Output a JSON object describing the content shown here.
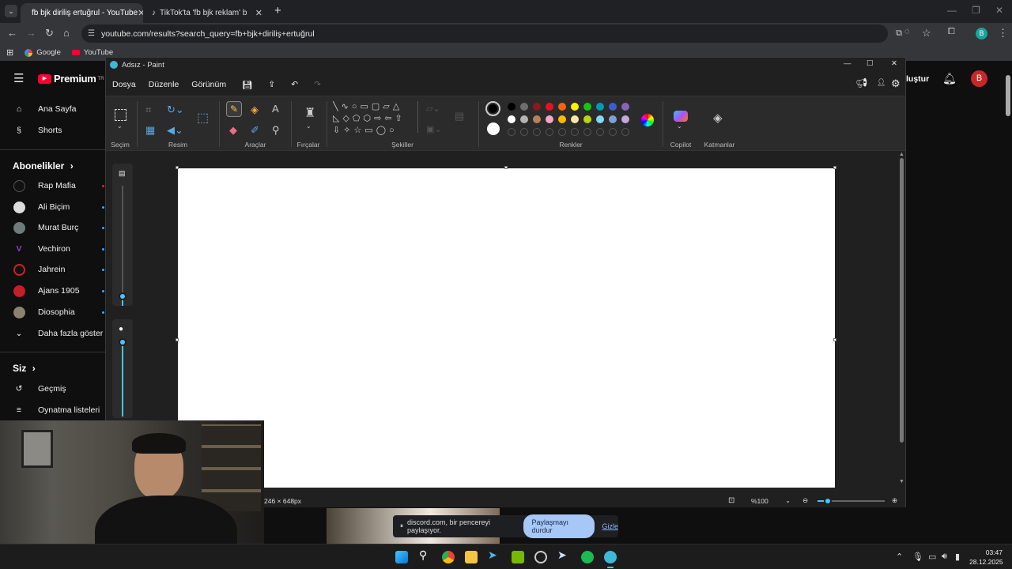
{
  "browser": {
    "tabs": [
      {
        "label": "fb bjk diriliş ertuğrul - YouTube",
        "active": true
      },
      {
        "label": "TikTok'ta 'fb bjk reklam' bulabil",
        "active": false
      }
    ],
    "new_tab": "+",
    "url": "youtube.com/results?search_query=fb+bjk+diriliş+ertuğrul",
    "bookmarks": [
      "Google",
      "YouTube"
    ],
    "profile_initial": "B"
  },
  "youtube": {
    "logo": "Premium",
    "logo_sup": "TR",
    "nav": [
      "Ana Sayfa",
      "Shorts"
    ],
    "subs_title": "Abonelikler",
    "subs": [
      "Rap Mafia",
      "Ali Biçim",
      "Murat Burç",
      "Vechiron",
      "Jahrein",
      "Ajans 1905",
      "Diosophia"
    ],
    "more": "Daha fazla göster",
    "you_title": "Siz",
    "you_items": [
      "Geçmiş",
      "Oynatma listeleri"
    ],
    "create_label": "luştur",
    "avatar_initial": "B"
  },
  "paint": {
    "title": "Adsız - Paint",
    "menu": [
      "Dosya",
      "Düzenle",
      "Görünüm"
    ],
    "groups": [
      "Seçim",
      "Resim",
      "Araçlar",
      "Fırçalar",
      "Şekiller",
      "Renkler",
      "Copilot",
      "Katmanlar"
    ],
    "size_text": "246 × 648px",
    "zoom": "%100",
    "palette_row1": [
      "#000000",
      "#6e6e6e",
      "#8b1a1a",
      "#e81123",
      "#f7630c",
      "#fff100",
      "#16c60c",
      "#0099bc",
      "#3a5fcd",
      "#8764b8"
    ],
    "palette_row2": [
      "#ffffff",
      "#b4b4b4",
      "#b5835a",
      "#f4a7c6",
      "#ffb900",
      "#ffe8a3",
      "#bad80a",
      "#84d8f0",
      "#7da0d8",
      "#c4a6e0"
    ]
  },
  "discord": {
    "message": "discord.com, bir pencereyi paylaşıyor.",
    "stop": "Paylaşmayı durdur",
    "hide": "Gizle"
  },
  "taskbar": {
    "time": "03:47",
    "date": "28.12.2025"
  }
}
